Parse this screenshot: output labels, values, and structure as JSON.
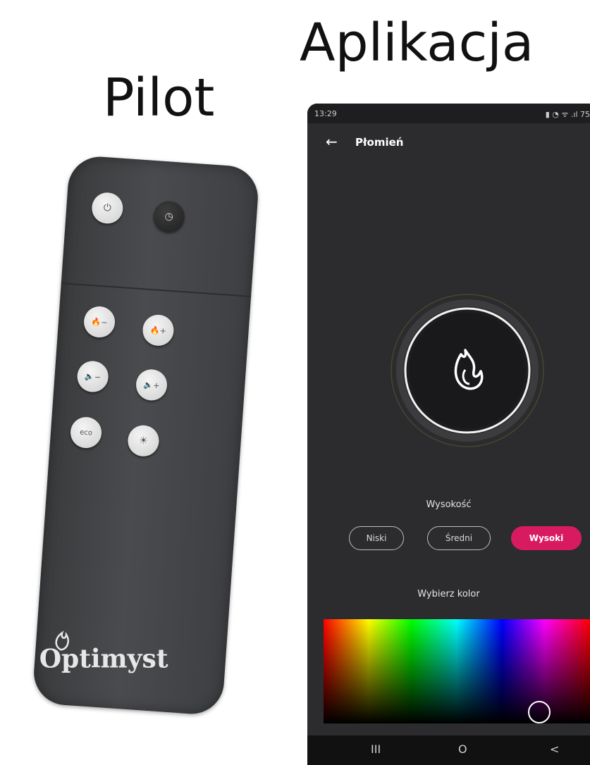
{
  "headings": {
    "remote": "Pilot",
    "app": "Aplikacja"
  },
  "remote": {
    "buttons": [
      {
        "name": "power-button",
        "label": "⏻"
      },
      {
        "name": "timer-button",
        "label": "◷"
      },
      {
        "name": "flame-down-button",
        "label": "🔥−"
      },
      {
        "name": "flame-up-button",
        "label": "🔥+"
      },
      {
        "name": "sound-down-button",
        "label": "🔈−"
      },
      {
        "name": "sound-up-button",
        "label": "🔈+"
      },
      {
        "name": "eco-button",
        "label": "eco"
      },
      {
        "name": "light-button",
        "label": "☀"
      }
    ],
    "brand": "Optimyst"
  },
  "app": {
    "status_time": "13:29",
    "status_right": "▮ ◔ ᯤ .ıl 75",
    "title": "Płomień",
    "back_icon": "←",
    "height_label": "Wysokość",
    "height_options": [
      "Niski",
      "Średni",
      "Wysoki"
    ],
    "height_selected": "Wysoki",
    "color_label": "Wybierz kolor",
    "nav": {
      "recent": "III",
      "home": "O",
      "back": "<"
    },
    "colors": {
      "accent": "#d81b60",
      "background": "#2c2c2e"
    }
  }
}
